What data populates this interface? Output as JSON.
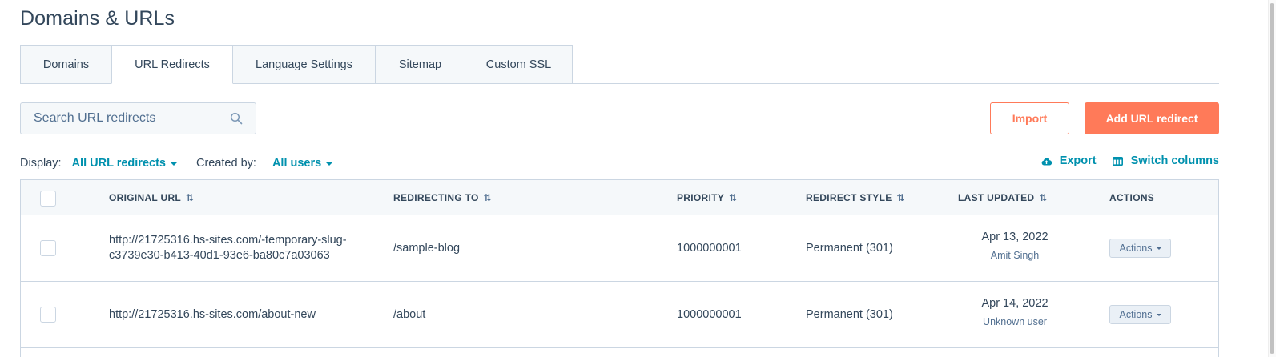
{
  "page_title": "Domains & URLs",
  "tabs": [
    {
      "label": "Domains"
    },
    {
      "label": "URL Redirects",
      "active": true
    },
    {
      "label": "Language Settings"
    },
    {
      "label": "Sitemap"
    },
    {
      "label": "Custom SSL"
    }
  ],
  "search": {
    "placeholder": "Search URL redirects",
    "icon": "search-icon"
  },
  "buttons": {
    "import": "Import",
    "add": "Add URL redirect"
  },
  "filters": {
    "display_label": "Display:",
    "display_value": "All URL redirects",
    "created_label": "Created by:",
    "created_value": "All users"
  },
  "tools": {
    "export": "Export",
    "switch_columns": "Switch columns"
  },
  "table": {
    "headers": {
      "original_url": "ORIGINAL URL",
      "redirecting_to": "REDIRECTING TO",
      "priority": "PRIORITY",
      "redirect_style": "REDIRECT STYLE",
      "last_updated": "LAST UPDATED",
      "actions": "ACTIONS"
    },
    "rows": [
      {
        "original_url_line1": "http://21725316.hs-sites.com/-temporary-slug-",
        "original_url_line2": "c3739e30-b413-40d1-93e6-ba80c7a03063",
        "redirecting_to": "/sample-blog",
        "priority": "1000000001",
        "redirect_style": "Permanent (301)",
        "date": "Apr 13, 2022",
        "user": "Amit Singh",
        "action": "Actions"
      },
      {
        "original_url_line1": "http://21725316.hs-sites.com/about-new",
        "original_url_line2": "",
        "redirecting_to": "/about",
        "priority": "1000000001",
        "redirect_style": "Permanent (301)",
        "date": "Apr 14, 2022",
        "user": "Unknown user",
        "action": "Actions"
      }
    ]
  },
  "colors": {
    "accent": "#ff7a59",
    "link": "#0091ae",
    "text": "#33475b",
    "border": "#cbd6e2"
  }
}
